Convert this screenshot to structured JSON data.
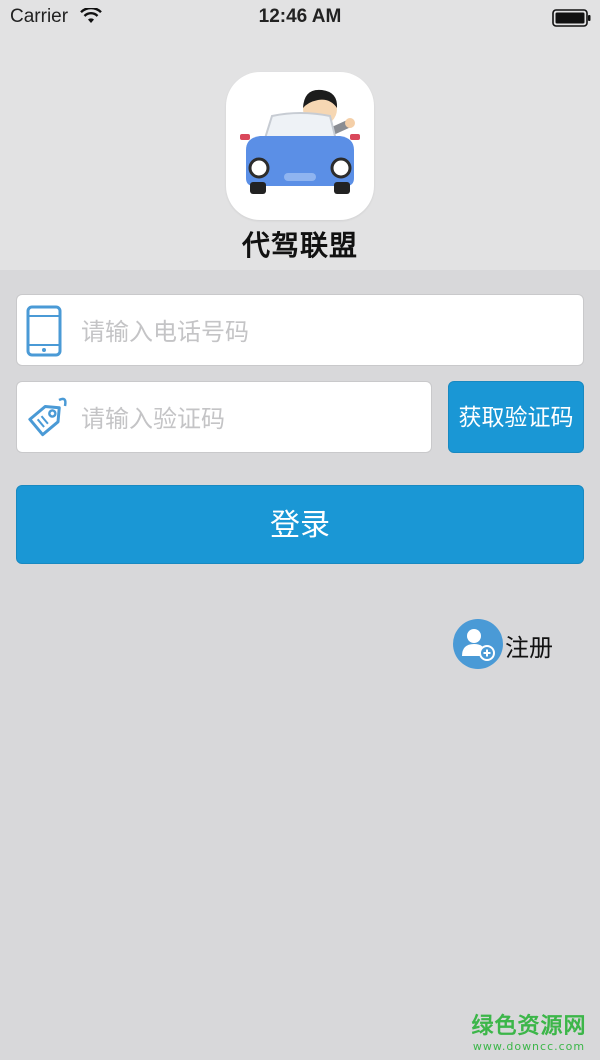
{
  "status_bar": {
    "carrier": "Carrier",
    "time": "12:46 AM"
  },
  "app": {
    "name": "代驾联盟",
    "accent_color": "#1a97d5"
  },
  "form": {
    "phone_placeholder": "请输入电话号码",
    "phone_value": "",
    "code_placeholder": "请输入验证码",
    "code_value": "",
    "get_code_label": "获取验证码",
    "login_label": "登录"
  },
  "register": {
    "label": "注册",
    "icon": "add-user-icon"
  },
  "watermark": {
    "main": "绿色资源网",
    "sub": "www.downcc.com"
  }
}
